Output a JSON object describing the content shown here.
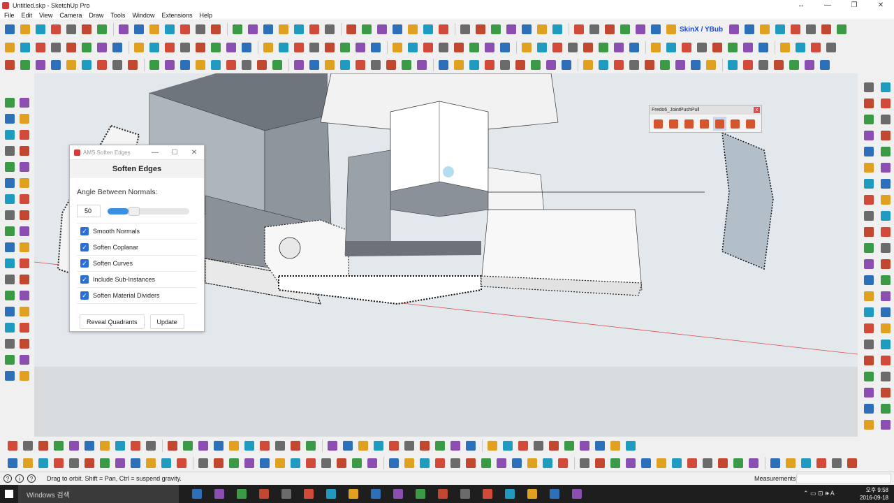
{
  "window": {
    "title": "Untitled.skp - SketchUp Pro",
    "controls": [
      "↔",
      "—",
      "❐",
      "✕"
    ]
  },
  "menu": [
    "File",
    "Edit",
    "View",
    "Camera",
    "Draw",
    "Tools",
    "Window",
    "Extensions",
    "Help"
  ],
  "skinx_label": "SkinX / YBub",
  "dialog": {
    "title": "AMS Soften Edges",
    "heading": "Soften Edges",
    "subheading": "Angle Between Normals:",
    "angle_value": "50",
    "slider_fraction": 0.26,
    "options": [
      {
        "label": "Smooth Normals",
        "checked": true
      },
      {
        "label": "Soften Coplanar",
        "checked": true
      },
      {
        "label": "Soften Curves",
        "checked": true
      },
      {
        "label": "Include Sub-Instances",
        "checked": true
      },
      {
        "label": "Soften Material Dividers",
        "checked": true
      }
    ],
    "reveal_button": "Reveal Quadrants",
    "update_button": "Update"
  },
  "fredo_panel": {
    "title": "Fredo6_JointPushPull",
    "close": "x"
  },
  "status": {
    "hint": "Drag to orbit. Shift = Pan, Ctrl = suspend gravity.",
    "measurements_label": "Measurements"
  },
  "taskbar": {
    "search_placeholder": "Windows 검색",
    "tray_text": "⌃ ▭ ⊡ 🕪 A",
    "time": "오후 9:58",
    "date": "2016-09-18"
  },
  "colors": {
    "accent": "#2a6fd6",
    "slider": "#3b8fe0",
    "red_axis": "#d94b4b"
  }
}
